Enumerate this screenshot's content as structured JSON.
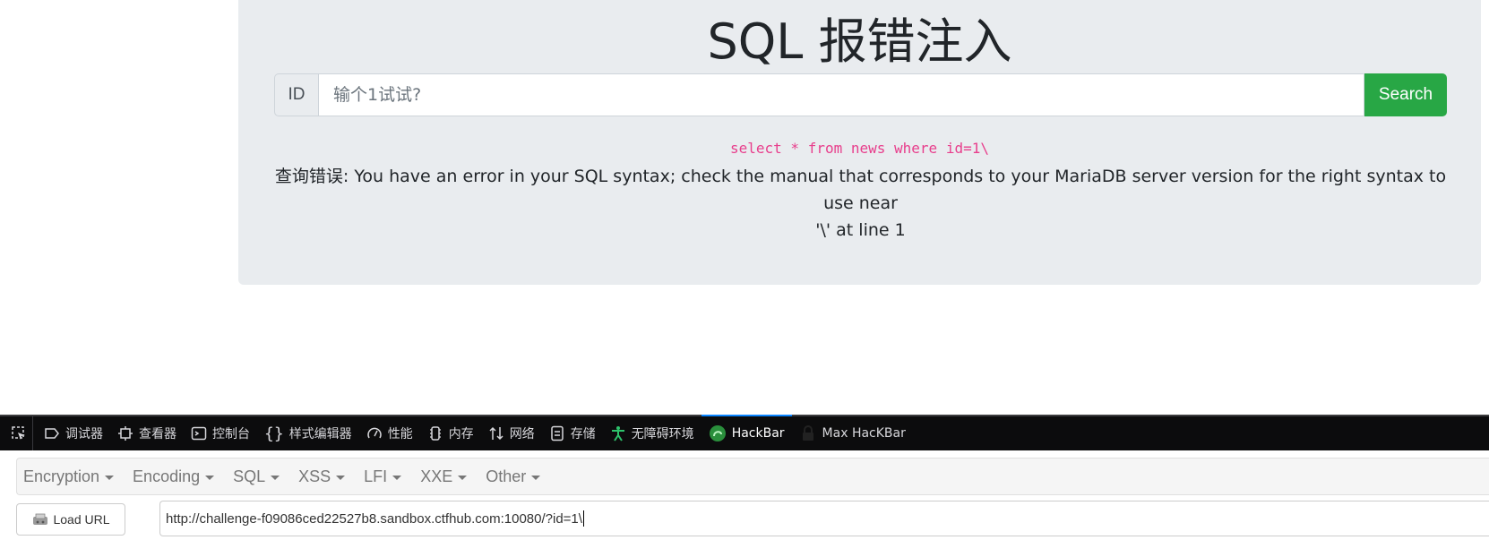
{
  "page": {
    "title": "SQL 报错注入",
    "search": {
      "prefix": "ID",
      "placeholder": "输个1试试?",
      "button": "Search"
    },
    "query": "select * from news where id=1\\",
    "error_line1": "查询错误: You have an error in your SQL syntax; check the manual that corresponds to your MariaDB server version for the right syntax to use near",
    "error_line2": "'\\' at line 1"
  },
  "devtools": {
    "tabs": [
      {
        "label": "调试器",
        "icon": "debugger-icon"
      },
      {
        "label": "查看器",
        "icon": "inspector-icon"
      },
      {
        "label": "控制台",
        "icon": "console-icon"
      },
      {
        "label": "样式编辑器",
        "icon": "style-editor-icon"
      },
      {
        "label": "性能",
        "icon": "performance-icon"
      },
      {
        "label": "内存",
        "icon": "memory-icon"
      },
      {
        "label": "网络",
        "icon": "network-icon"
      },
      {
        "label": "存储",
        "icon": "storage-icon"
      },
      {
        "label": "无障碍环境",
        "icon": "accessibility-icon"
      },
      {
        "label": "HackBar",
        "icon": "hackbar-icon",
        "active": true
      },
      {
        "label": "Max HacKBar",
        "icon": "lock-icon"
      }
    ]
  },
  "hackbar": {
    "menu": [
      "Encryption",
      "Encoding",
      "SQL",
      "XSS",
      "LFI",
      "XXE",
      "Other"
    ],
    "load_url": "Load URL",
    "url": "http://challenge-f09086ced22527b8.sandbox.ctfhub.com:10080/?id=1\\"
  },
  "colors": {
    "card_bg": "#e9ecef",
    "search_button": "#28a745",
    "code": "#e83e8c",
    "devtools_bar": "#0c0c0d",
    "active_tab": "#0a84ff"
  }
}
